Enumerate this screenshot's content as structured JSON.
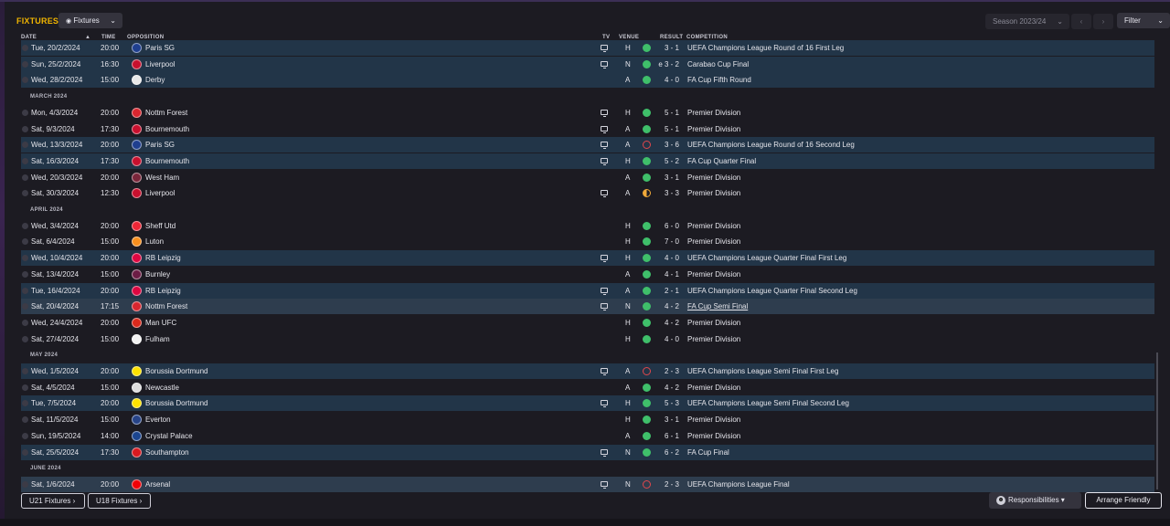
{
  "header": {
    "title": "FIXTURES",
    "view_dropdown": "Fixtures",
    "season_dropdown": "Season 2023/24",
    "prev": "‹",
    "next": "›",
    "filter": "Filter"
  },
  "columns": {
    "date": "DATE",
    "time": "TIME",
    "opposition": "OPPOSITION",
    "tv": "TV",
    "venue": "VENUE",
    "result": "RESULT",
    "competition": "COMPETITION"
  },
  "rows": [
    {
      "kind": "match",
      "style": "hl",
      "date": "Tue, 20/2/2024",
      "time": "20:00",
      "opp": "Paris SG",
      "badge": "#1f3f8f",
      "tv": true,
      "venue": "H",
      "res": "win",
      "score": "3 - 1",
      "comp": "UEFA Champions League Round of 16 First Leg"
    },
    {
      "kind": "match",
      "style": "hl",
      "date": "Sun, 25/2/2024",
      "time": "16:30",
      "opp": "Liverpool",
      "badge": "#c8102e",
      "tv": true,
      "venue": "N",
      "res": "win",
      "score": "e 3 - 2",
      "comp": "Carabao Cup Final"
    },
    {
      "kind": "match",
      "style": "hl",
      "date": "Wed, 28/2/2024",
      "time": "15:00",
      "opp": "Derby",
      "badge": "#e8e8e8",
      "tv": false,
      "venue": "A",
      "res": "win",
      "score": "4 - 0",
      "comp": "FA Cup Fifth Round"
    },
    {
      "kind": "month",
      "label": "MARCH 2024"
    },
    {
      "kind": "match",
      "style": "normal",
      "date": "Mon, 4/3/2024",
      "time": "20:00",
      "opp": "Nottm Forest",
      "badge": "#d8262f",
      "tv": true,
      "venue": "H",
      "res": "win",
      "score": "5 - 1",
      "comp": "Premier Division"
    },
    {
      "kind": "match",
      "style": "normal",
      "date": "Sat, 9/3/2024",
      "time": "17:30",
      "opp": "Bournemouth",
      "badge": "#c8102e",
      "tv": true,
      "venue": "A",
      "res": "win",
      "score": "5 - 1",
      "comp": "Premier Division"
    },
    {
      "kind": "match",
      "style": "hl",
      "date": "Wed, 13/3/2024",
      "time": "20:00",
      "opp": "Paris SG",
      "badge": "#1f3f8f",
      "tv": true,
      "venue": "A",
      "res": "loss",
      "score": "3 - 6",
      "comp": "UEFA Champions League Round of 16 Second Leg"
    },
    {
      "kind": "match",
      "style": "hl",
      "date": "Sat, 16/3/2024",
      "time": "17:30",
      "opp": "Bournemouth",
      "badge": "#c8102e",
      "tv": true,
      "venue": "H",
      "res": "win",
      "score": "5 - 2",
      "comp": "FA Cup Quarter Final"
    },
    {
      "kind": "match",
      "style": "normal",
      "date": "Wed, 20/3/2024",
      "time": "20:00",
      "opp": "West Ham",
      "badge": "#7a263a",
      "tv": false,
      "venue": "A",
      "res": "win",
      "score": "3 - 1",
      "comp": "Premier Division"
    },
    {
      "kind": "match",
      "style": "normal",
      "date": "Sat, 30/3/2024",
      "time": "12:30",
      "opp": "Liverpool",
      "badge": "#c8102e",
      "tv": true,
      "venue": "A",
      "res": "draw",
      "score": "3 - 3",
      "comp": "Premier Division"
    },
    {
      "kind": "month",
      "label": "APRIL 2024"
    },
    {
      "kind": "match",
      "style": "normal",
      "date": "Wed, 3/4/2024",
      "time": "20:00",
      "opp": "Sheff Utd",
      "badge": "#ee2737",
      "tv": false,
      "venue": "H",
      "res": "win",
      "score": "6 - 0",
      "comp": "Premier Division"
    },
    {
      "kind": "match",
      "style": "normal",
      "date": "Sat, 6/4/2024",
      "time": "15:00",
      "opp": "Luton",
      "badge": "#f78f1e",
      "tv": false,
      "venue": "H",
      "res": "win",
      "score": "7 - 0",
      "comp": "Premier Division"
    },
    {
      "kind": "match",
      "style": "hl",
      "date": "Wed, 10/4/2024",
      "time": "20:00",
      "opp": "RB Leipzig",
      "badge": "#dd0741",
      "tv": true,
      "venue": "H",
      "res": "win",
      "score": "4 - 0",
      "comp": "UEFA Champions League Quarter Final First Leg"
    },
    {
      "kind": "match",
      "style": "normal",
      "date": "Sat, 13/4/2024",
      "time": "15:00",
      "opp": "Burnley",
      "badge": "#6c1d45",
      "tv": false,
      "venue": "A",
      "res": "win",
      "score": "4 - 1",
      "comp": "Premier Division"
    },
    {
      "kind": "match",
      "style": "hl",
      "date": "Tue, 16/4/2024",
      "time": "20:00",
      "opp": "RB Leipzig",
      "badge": "#dd0741",
      "tv": true,
      "venue": "A",
      "res": "win",
      "score": "2 - 1",
      "comp": "UEFA Champions League Quarter Final Second Leg"
    },
    {
      "kind": "match",
      "style": "sel",
      "date": "Sat, 20/4/2024",
      "time": "17:15",
      "opp": "Nottm Forest",
      "badge": "#d8262f",
      "tv": true,
      "venue": "N",
      "res": "win",
      "score": "4 - 2",
      "comp": "FA Cup Semi Final",
      "underline": true
    },
    {
      "kind": "match",
      "style": "normal",
      "date": "Wed, 24/4/2024",
      "time": "20:00",
      "opp": "Man UFC",
      "badge": "#da291c",
      "tv": false,
      "venue": "H",
      "res": "win",
      "score": "4 - 2",
      "comp": "Premier Division"
    },
    {
      "kind": "match",
      "style": "normal",
      "date": "Sat, 27/4/2024",
      "time": "15:00",
      "opp": "Fulham",
      "badge": "#f2f2f2",
      "tv": false,
      "venue": "H",
      "res": "win",
      "score": "4 - 0",
      "comp": "Premier Division"
    },
    {
      "kind": "month",
      "label": "MAY 2024"
    },
    {
      "kind": "match",
      "style": "hl",
      "date": "Wed, 1/5/2024",
      "time": "20:00",
      "opp": "Borussia Dortmund",
      "badge": "#fde100",
      "tv": true,
      "venue": "A",
      "res": "loss",
      "score": "2 - 3",
      "comp": "UEFA Champions League Semi Final First Leg"
    },
    {
      "kind": "match",
      "style": "normal",
      "date": "Sat, 4/5/2024",
      "time": "15:00",
      "opp": "Newcastle",
      "badge": "#dddddd",
      "tv": false,
      "venue": "A",
      "res": "win",
      "score": "4 - 2",
      "comp": "Premier Division"
    },
    {
      "kind": "match",
      "style": "hl",
      "date": "Tue, 7/5/2024",
      "time": "20:00",
      "opp": "Borussia Dortmund",
      "badge": "#fde100",
      "tv": true,
      "venue": "H",
      "res": "win",
      "score": "5 - 3",
      "comp": "UEFA Champions League Semi Final Second Leg"
    },
    {
      "kind": "match",
      "style": "normal",
      "date": "Sat, 11/5/2024",
      "time": "15:00",
      "opp": "Everton",
      "badge": "#274488",
      "tv": false,
      "venue": "H",
      "res": "win",
      "score": "3 - 1",
      "comp": "Premier Division"
    },
    {
      "kind": "match",
      "style": "normal",
      "date": "Sun, 19/5/2024",
      "time": "14:00",
      "opp": "Crystal Palace",
      "badge": "#1b458f",
      "tv": false,
      "venue": "A",
      "res": "win",
      "score": "6 - 1",
      "comp": "Premier Division"
    },
    {
      "kind": "match",
      "style": "hl",
      "date": "Sat, 25/5/2024",
      "time": "17:30",
      "opp": "Southampton",
      "badge": "#d71920",
      "tv": true,
      "venue": "N",
      "res": "win",
      "score": "6 - 2",
      "comp": "FA Cup Final"
    },
    {
      "kind": "month",
      "label": "JUNE 2024"
    },
    {
      "kind": "match",
      "style": "sel",
      "date": "Sat, 1/6/2024",
      "time": "20:00",
      "opp": "Arsenal",
      "badge": "#ef0107",
      "tv": true,
      "venue": "N",
      "res": "loss",
      "score": "2 - 3",
      "comp": "UEFA Champions League Final"
    }
  ],
  "footer": {
    "u21": "U21 Fixtures ›",
    "u18": "U18 Fixtures ›",
    "responsibilities": "Responsibilities ▾",
    "arrange": "Arrange Friendly"
  }
}
